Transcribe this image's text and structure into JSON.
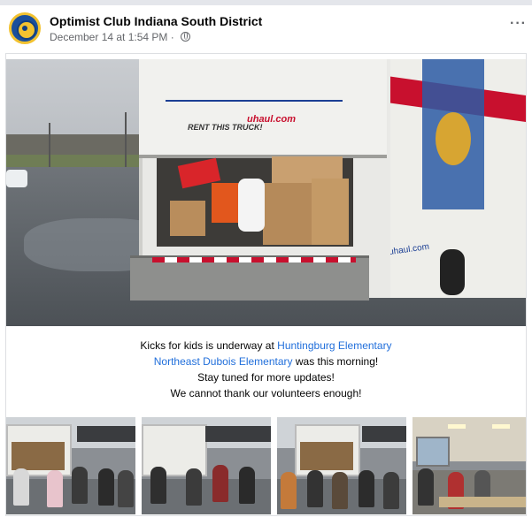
{
  "post": {
    "page_name": "Optimist Club Indiana South District",
    "timestamp": "December 14 at 1:54 PM",
    "separator": "·",
    "privacy_icon": "globe-icon",
    "more_icon": "more-options-icon",
    "more_label": "···"
  },
  "caption": {
    "line1_text": "Kicks for kids is underway at ",
    "line1_link": "Huntingburg Elementary",
    "line2_link": "Northeast Dubois Elementary",
    "line2_text": " was this morning!",
    "line3": "Stay tuned for more updates!",
    "line4": "We cannot thank our volunteers enough!"
  },
  "photo": {
    "truck_slogan": "RENT THIS TRUCK!",
    "truck_brand": "uhaul.com",
    "side_text": "uhaul.com"
  },
  "colors": {
    "link": "#216fdb",
    "text": "#050505",
    "meta": "#65676b",
    "brand_red": "#c8102e"
  }
}
